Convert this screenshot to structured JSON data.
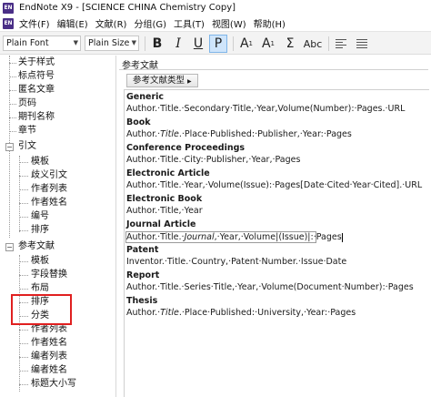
{
  "window": {
    "app_icon": "EN",
    "title": "EndNote X9 - [SCIENCE CHINA Chemistry Copy]"
  },
  "menubar": {
    "icon": "EN",
    "items": [
      "文件(F)",
      "编辑(E)",
      "文献(R)",
      "分组(G)",
      "工具(T)",
      "视图(W)",
      "帮助(H)"
    ]
  },
  "toolbar": {
    "font_select": "Plain Font",
    "size_select": "Plain Size",
    "bold": "B",
    "italic": "I",
    "underline": "U",
    "plain": "P",
    "superscript": "A",
    "subscript": "A",
    "sigma": "Σ",
    "smallcaps": "Abc",
    "active_color": "#cfe5fb"
  },
  "tree": {
    "top_items": [
      "关于样式",
      "标点符号",
      "匿名文章",
      "页码",
      "期刊名称",
      "章节"
    ],
    "citation_group": "引文",
    "citation_items": [
      "模板",
      "歧义引文",
      "作者列表",
      "作者姓名",
      "编号",
      "排序"
    ],
    "bibliography_group": "参考文献",
    "bibliography_items": [
      "模板",
      "字段替换",
      "布局",
      "排序",
      "分类",
      "作者列表",
      "作者姓名",
      "编者列表",
      "编者姓名",
      "标题大小写"
    ],
    "highlight_color": "#e02020"
  },
  "main": {
    "header": "参考文献",
    "type_button": "参考文献类型",
    "references": [
      {
        "type": "Generic",
        "template": "Author.·Title.·Secondary·Title,·Year,Volume(Number):·Pages.·URL"
      },
      {
        "type": "Book",
        "template_parts": [
          "Author.·",
          "Title",
          ".·Place·Published:·Publisher,·Year:·Pages"
        ]
      },
      {
        "type": "Conference Proceedings",
        "template": "Author.·Title.·City:·Publisher,·Year,·Pages"
      },
      {
        "type": "Electronic Article",
        "template": "Author.·Title.·Year,·Volume(Issue):·Pages[Date·Cited·Year·Cited].·URL"
      },
      {
        "type": "Electronic Book",
        "template": "Author.·Title,·Year"
      },
      {
        "type": "Journal Article",
        "template_parts": [
          "Author.·Title.·",
          "Journal",
          ",·Year,·Volume|(Issue)|:·Pages"
        ]
      },
      {
        "type": "Patent",
        "template": "Inventor.·Title.·Country,·Patent·Number.·Issue·Date"
      },
      {
        "type": "Report",
        "template": "Author.·Title.·Series·Title,·Year,·Volume(Document·Number):·Pages"
      },
      {
        "type": "Thesis",
        "template_parts": [
          "Author.·",
          "Title",
          ".·Place·Published:·University,·Year:·Pages"
        ]
      }
    ]
  }
}
